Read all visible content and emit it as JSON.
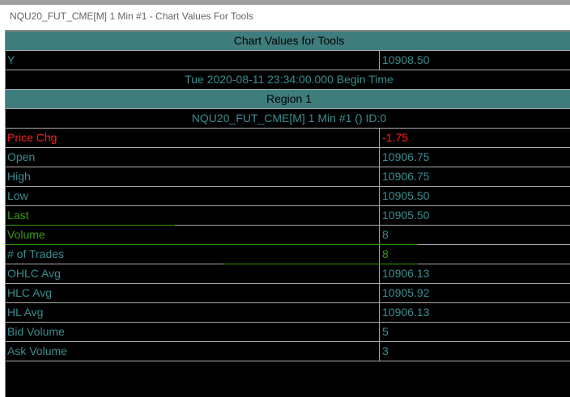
{
  "window_title": "NQU20_FUT_CME[M]  1 Min   #1 - Chart Values For Tools",
  "header": "Chart Values for Tools",
  "y_row": {
    "label": "Y",
    "value": "10908.50"
  },
  "time": "Tue 2020-08-11  23:34:00.000 Begin Time",
  "region": "Region 1",
  "symbol_line": "NQU20_FUT_CME[M]  1 Min   #1 ()   ID:0",
  "rows": [
    {
      "label": "Price Chg",
      "value": "-1.75"
    },
    {
      "label": "Open",
      "value": "10906.75"
    },
    {
      "label": "High",
      "value": "10906.75"
    },
    {
      "label": "Low",
      "value": "10905.50"
    },
    {
      "label": "Last",
      "value": "10905.50"
    },
    {
      "label": "Volume",
      "value": "8"
    },
    {
      "label": "# of Trades",
      "value": "8"
    },
    {
      "label": "OHLC Avg",
      "value": "10906.13"
    },
    {
      "label": "HLC Avg",
      "value": "10905.92"
    },
    {
      "label": "HL Avg",
      "value": "10906.13"
    },
    {
      "label": "Bid Volume",
      "value": "5"
    },
    {
      "label": "Ask Volume",
      "value": "3"
    }
  ]
}
